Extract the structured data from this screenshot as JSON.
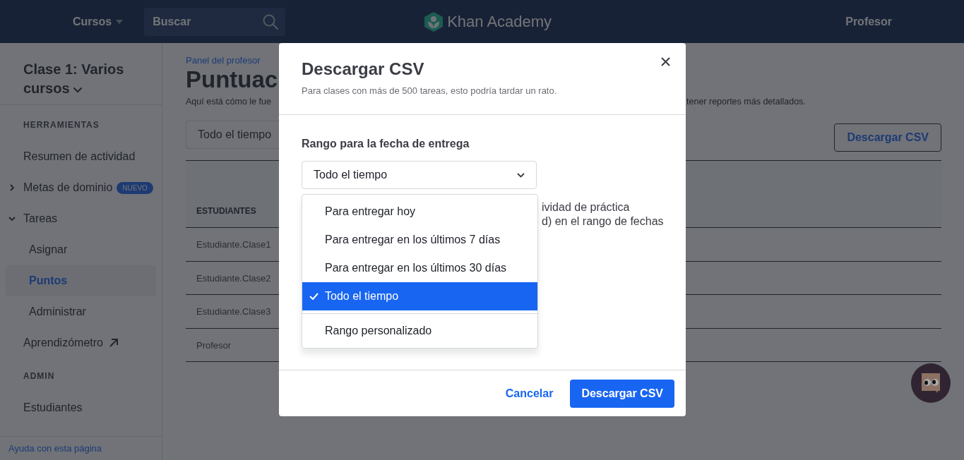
{
  "header": {
    "courses_menu": "Cursos",
    "search_placeholder": "Buscar",
    "logo_text": "Khan Academy",
    "user": "Profesor"
  },
  "sidebar": {
    "class_title": "Clase 1: Varios cursos",
    "sections": [
      {
        "heading": "HERRAMIENTAS",
        "items": [
          {
            "label": "Resumen de actividad",
            "kind": "link",
            "selected": false
          },
          {
            "label": "Metas de dominio",
            "kind": "expandable",
            "expanded": false,
            "badge": "NUEVO",
            "selected": false
          },
          {
            "label": "Tareas",
            "kind": "expandable",
            "expanded": true,
            "selected": false,
            "children": [
              {
                "label": "Asignar",
                "selected": false
              },
              {
                "label": "Puntos",
                "selected": true
              },
              {
                "label": "Administrar",
                "selected": false
              }
            ]
          },
          {
            "label": "Aprendizómetro",
            "kind": "external",
            "selected": false
          }
        ]
      },
      {
        "heading": "ADMIN",
        "items": [
          {
            "label": "Estudiantes",
            "kind": "link",
            "selected": false
          }
        ]
      }
    ],
    "help_link": "Ayuda con esta página"
  },
  "main": {
    "breadcrumb": "Panel del profesor",
    "title": "Puntuac",
    "intro_left": "Aquí está cómo le fue",
    "intro_right": "tener reportes más detallados.",
    "filter_button": "Todo el tiempo",
    "download_button": "Descargar CSV",
    "table": {
      "column_1_header": "ESTUDIANTES",
      "rows": [
        "Estudiante.Clase1",
        "Estudiante.Clase2",
        "Estudiante.Clase3",
        "Profesor"
      ]
    }
  },
  "modal": {
    "title": "Descargar CSV",
    "subtitle": "Para clases con más de 500 tareas, esto podría tardar un rato.",
    "field_label": "Rango para la fecha de entrega",
    "select_value": "Todo el tiempo",
    "options": [
      {
        "label": "Para entregar hoy",
        "selected": false
      },
      {
        "label": "Para entregar en los últimos 7 días",
        "selected": false
      },
      {
        "label": "Para entregar en los últimos 30 días",
        "selected": false
      },
      {
        "label": "Todo el tiempo",
        "selected": true
      },
      {
        "label": "Rango personalizado",
        "selected": false,
        "separated": true
      }
    ],
    "description_lines": [
      "ividad de práctica",
      "d) en el rango de fechas"
    ],
    "cancel": "Cancelar",
    "confirm": "Descargar CSV"
  }
}
